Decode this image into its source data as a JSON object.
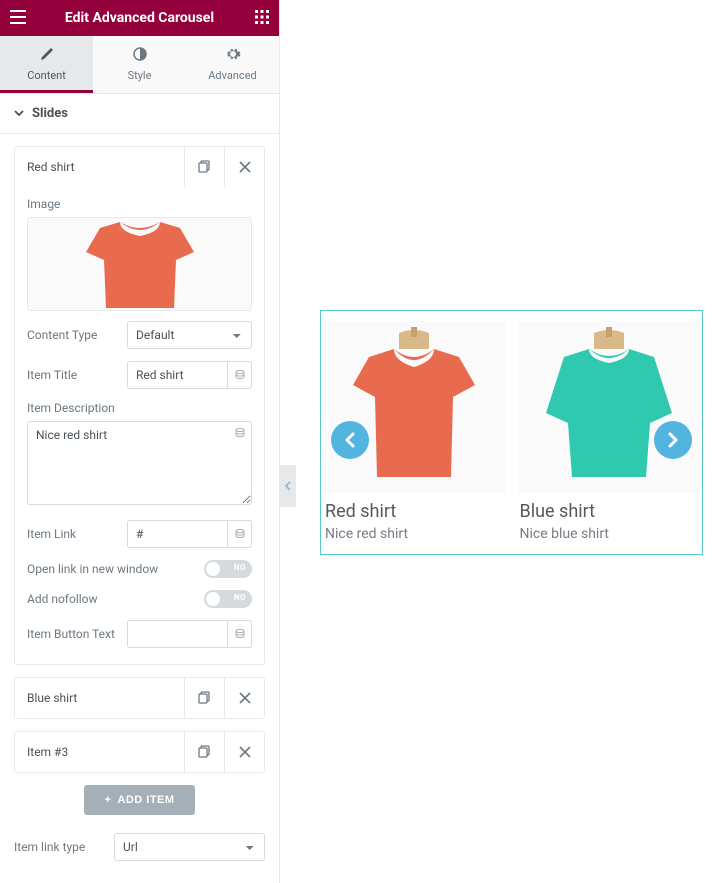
{
  "header": {
    "title": "Edit Advanced Carousel"
  },
  "tabs": {
    "content": "Content",
    "style": "Style",
    "advanced": "Advanced"
  },
  "section": {
    "title": "Slides"
  },
  "items": [
    {
      "title": "Red shirt"
    },
    {
      "title": "Blue shirt"
    },
    {
      "title": "Item #3"
    }
  ],
  "fields": {
    "image_label": "Image",
    "content_type_label": "Content Type",
    "content_type_value": "Default",
    "item_title_label": "Item Title",
    "item_title_value": "Red shirt",
    "item_desc_label": "Item Description",
    "item_desc_value": "Nice red shirt",
    "item_link_label": "Item Link",
    "item_link_value": "#",
    "open_new_label": "Open link in new window",
    "open_new_state": "NO",
    "nofollow_label": "Add nofollow",
    "nofollow_state": "NO",
    "button_text_label": "Item Button Text",
    "button_text_value": ""
  },
  "add_button": "ADD ITEM",
  "item_link_type_label": "Item link type",
  "item_link_type_value": "Url",
  "preview": {
    "slides": [
      {
        "title": "Red shirt",
        "desc": "Nice red shirt"
      },
      {
        "title": "Blue shirt",
        "desc": "Nice blue shirt"
      }
    ]
  },
  "colors": {
    "accent": "#93003c",
    "preview_border": "#5ac8c8",
    "nav": "#54b4e0",
    "red_shirt": "#e86a4f",
    "blue_shirt": "#2fc9b0"
  }
}
